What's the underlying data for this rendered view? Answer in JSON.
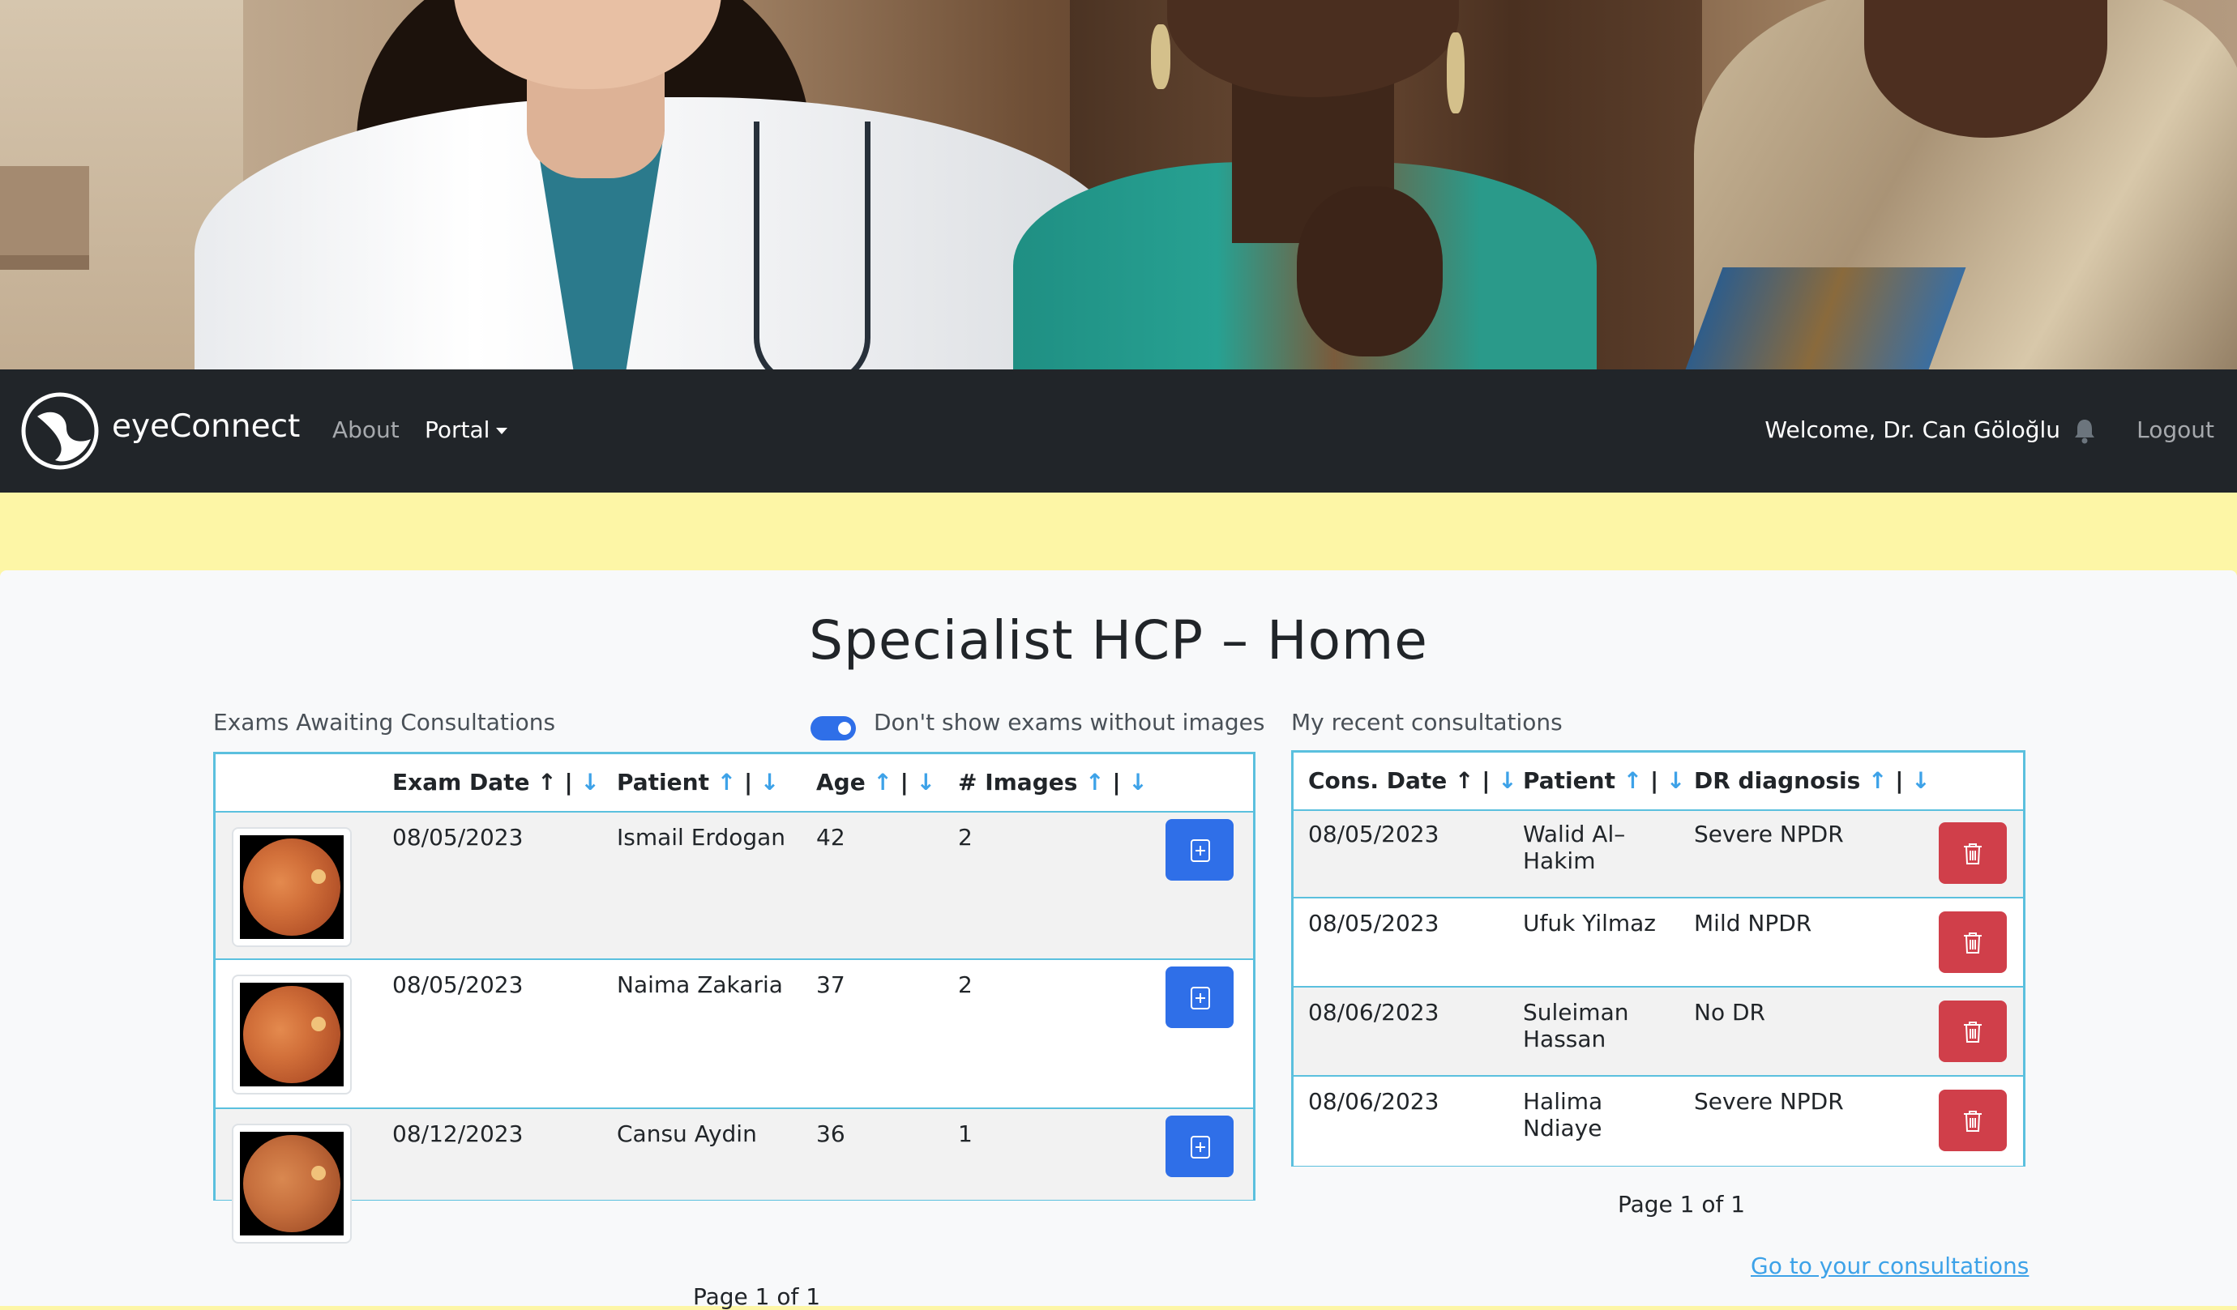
{
  "nav": {
    "brand": "eyeConnect",
    "about": "About",
    "portal": "Portal",
    "welcome": "Welcome, Dr. Can Göloğlu",
    "logout": "Logout"
  },
  "page": {
    "title": "Specialist HCP – Home"
  },
  "exams": {
    "label": "Exams Awaiting Consultations",
    "toggle_label": "Don't show exams without images",
    "toggle_on": true,
    "headers": {
      "date": "Exam Date",
      "patient": "Patient",
      "age": "Age",
      "images": "# Images"
    },
    "rows": [
      {
        "date": "08/05/2023",
        "patient": "Ismail Erdogan",
        "age": "42",
        "images": "2"
      },
      {
        "date": "08/05/2023",
        "patient": "Naima Zakaria",
        "age": "37",
        "images": "2"
      },
      {
        "date": "08/12/2023",
        "patient": "Cansu Aydin",
        "age": "36",
        "images": "1"
      }
    ],
    "pager": "Page 1 of 1"
  },
  "consults": {
    "label": "My recent consultations",
    "headers": {
      "date": "Cons. Date",
      "patient": "Patient",
      "diagnosis": "DR diagnosis"
    },
    "rows": [
      {
        "date": "08/05/2023",
        "patient_l1": "Walid Al–",
        "patient_l2": "Hakim",
        "diagnosis": "Severe NPDR"
      },
      {
        "date": "08/05/2023",
        "patient_l1": "Ufuk Yilmaz",
        "patient_l2": "",
        "diagnosis": "Mild NPDR"
      },
      {
        "date": "08/06/2023",
        "patient_l1": "Suleiman",
        "patient_l2": "Hassan",
        "diagnosis": "No DR"
      },
      {
        "date": "08/06/2023",
        "patient_l1": "Halima",
        "patient_l2": "Ndiaye",
        "diagnosis": "Severe NPDR"
      }
    ],
    "pager": "Page 1 of 1",
    "link": "Go to your consultations"
  },
  "sort_glyphs": {
    "up": "↑",
    "sep": "|",
    "down": "↓"
  },
  "colors": {
    "navbar": "#212529",
    "banner": "#fdf6a6",
    "table_border": "#5bc0de",
    "primary": "#2f6fe8",
    "danger": "#d03f4a",
    "link": "#3da2e8"
  }
}
